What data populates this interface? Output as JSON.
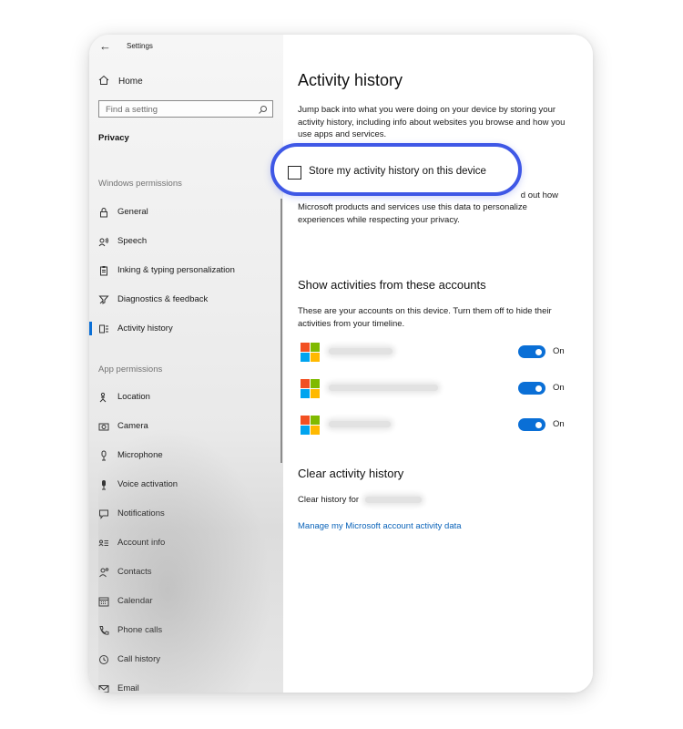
{
  "window": {
    "title": "Settings"
  },
  "sidebar": {
    "home_label": "Home",
    "search_placeholder": "Find a setting",
    "section_title": "Privacy",
    "group_windows": "Windows permissions",
    "group_app": "App permissions",
    "windows_items": [
      {
        "label": "General",
        "icon": "lock-icon"
      },
      {
        "label": "Speech",
        "icon": "speech-icon"
      },
      {
        "label": "Inking & typing personalization",
        "icon": "clipboard-icon"
      },
      {
        "label": "Diagnostics & feedback",
        "icon": "diagnostics-icon"
      },
      {
        "label": "Activity history",
        "icon": "activity-icon",
        "active": true
      }
    ],
    "app_items": [
      {
        "label": "Location",
        "icon": "location-icon"
      },
      {
        "label": "Camera",
        "icon": "camera-icon"
      },
      {
        "label": "Microphone",
        "icon": "microphone-icon"
      },
      {
        "label": "Voice activation",
        "icon": "voice-activation-icon"
      },
      {
        "label": "Notifications",
        "icon": "notifications-icon"
      },
      {
        "label": "Account info",
        "icon": "account-info-icon"
      },
      {
        "label": "Contacts",
        "icon": "contacts-icon"
      },
      {
        "label": "Calendar",
        "icon": "calendar-icon"
      },
      {
        "label": "Phone calls",
        "icon": "phone-icon"
      },
      {
        "label": "Call history",
        "icon": "call-history-icon"
      },
      {
        "label": "Email",
        "icon": "email-icon"
      }
    ]
  },
  "main": {
    "title": "Activity history",
    "intro": "Jump back into what you were doing on your device by storing your activity history, including info about websites you browse and how you use apps and services.",
    "store_checkbox_label": "Store my activity history on this device",
    "store_checkbox_checked": false,
    "partial_visible_text": "d out how",
    "microsoft_text": "Microsoft products and services use this data to personalize experiences while respecting your privacy.",
    "accounts_heading": "Show activities from these accounts",
    "accounts_desc": "These are your accounts on this device. Turn them off to hide their activities from your timeline.",
    "accounts": [
      {
        "state": "On",
        "enabled": true
      },
      {
        "state": "On",
        "enabled": true
      },
      {
        "state": "On",
        "enabled": true
      }
    ],
    "clear_heading": "Clear activity history",
    "clear_label": "Clear history for",
    "manage_link": "Manage my Microsoft account activity data"
  },
  "colors": {
    "accent": "#0a6fd6",
    "highlight_ring": "#3f58e6",
    "link": "#0a63b9",
    "ms_red": "#f25022",
    "ms_green": "#7fba00",
    "ms_blue": "#00a4ef",
    "ms_yellow": "#ffb900"
  }
}
